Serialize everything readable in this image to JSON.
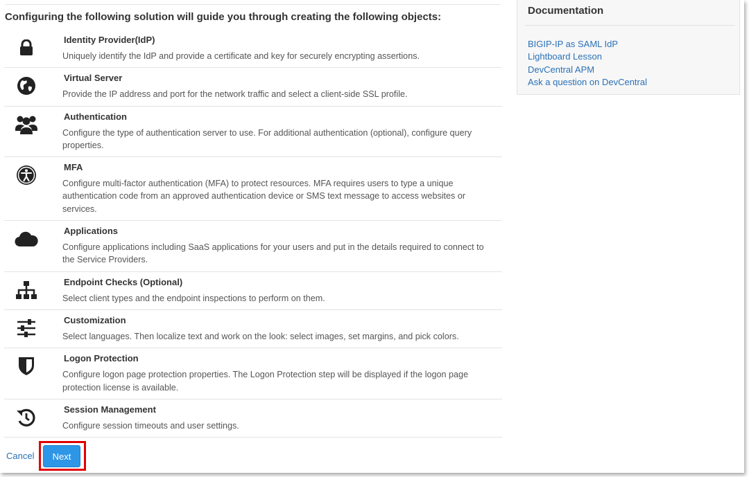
{
  "heading": "Configuring the following solution will guide you through creating the following objects:",
  "objects": [
    {
      "icon": "lock-icon",
      "title": "Identity Provider(IdP)",
      "description": "Uniquely identify the IdP and provide a certificate and key for securely encrypting assertions."
    },
    {
      "icon": "globe-icon",
      "title": "Virtual Server",
      "description": "Provide the IP address and port for the network traffic and select a client-side SSL profile."
    },
    {
      "icon": "users-icon",
      "title": "Authentication",
      "description": "Configure the type of authentication server to use. For additional authentication (optional), configure query properties."
    },
    {
      "icon": "accessibility-icon",
      "title": "MFA",
      "description": "Configure multi-factor authentication (MFA) to protect resources. MFA requires users to type a unique authentication code from an approved authentication device or SMS text message to access websites or services."
    },
    {
      "icon": "cloud-icon",
      "title": "Applications",
      "description": "Configure applications including SaaS applications for your users and put in the details required to connect to the Service Providers."
    },
    {
      "icon": "sitemap-icon",
      "title": "Endpoint Checks (Optional)",
      "description": "Select client types and the endpoint inspections to perform on them."
    },
    {
      "icon": "sliders-icon",
      "title": "Customization",
      "description": "Select languages. Then localize text and work on the look: select images, set margins, and pick colors."
    },
    {
      "icon": "shield-icon",
      "title": "Logon Protection",
      "description": "Configure logon page protection properties. The Logon Protection step will be displayed if the logon page protection license is available."
    },
    {
      "icon": "history-icon",
      "title": "Session Management",
      "description": "Configure session timeouts and user settings."
    }
  ],
  "footer": {
    "cancel_label": "Cancel",
    "next_label": "Next"
  },
  "documentation": {
    "title": "Documentation",
    "links": [
      "BIGIP-IP as SAML IdP",
      "Lightboard Lesson",
      "DevCentral APM",
      "Ask a question on DevCentral"
    ]
  },
  "colors": {
    "link": "#2a71b7",
    "primary_button": "#2d96e6",
    "highlight": "#e00000",
    "icon": "#222222"
  }
}
